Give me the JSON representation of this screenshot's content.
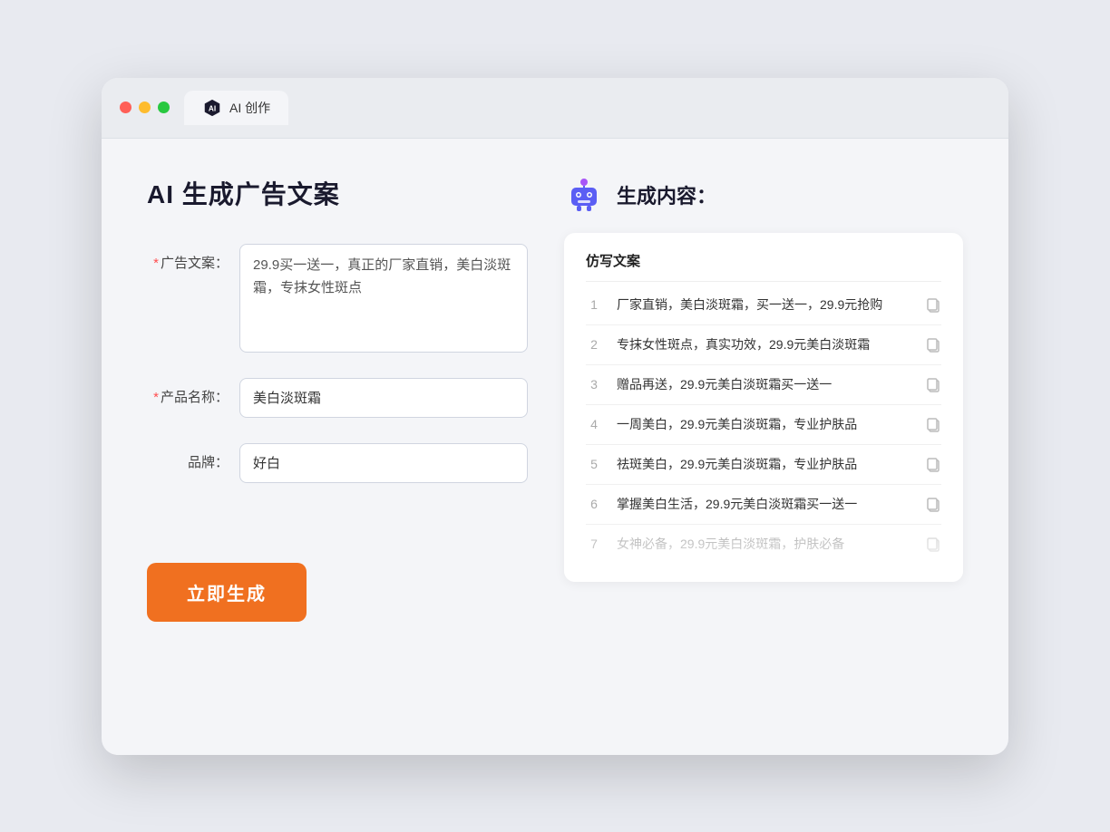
{
  "window": {
    "tab_label": "AI 创作"
  },
  "left_panel": {
    "title": "AI 生成广告文案",
    "fields": [
      {
        "id": "ad_copy",
        "label": "广告文案：",
        "required": true,
        "type": "textarea",
        "value": "29.9买一送一，真正的厂家直销，美白淡斑霜，专抹女性斑点"
      },
      {
        "id": "product_name",
        "label": "产品名称：",
        "required": true,
        "type": "text",
        "value": "美白淡斑霜"
      },
      {
        "id": "brand",
        "label": "品牌：",
        "required": false,
        "type": "text",
        "value": "好白"
      }
    ],
    "generate_btn": "立即生成"
  },
  "right_panel": {
    "title": "生成内容：",
    "column_header": "仿写文案",
    "results": [
      {
        "num": "1",
        "text": "厂家直销，美白淡斑霜，买一送一，29.9元抢购",
        "faded": false
      },
      {
        "num": "2",
        "text": "专抹女性斑点，真实功效，29.9元美白淡斑霜",
        "faded": false
      },
      {
        "num": "3",
        "text": "赠品再送，29.9元美白淡斑霜买一送一",
        "faded": false
      },
      {
        "num": "4",
        "text": "一周美白，29.9元美白淡斑霜，专业护肤品",
        "faded": false
      },
      {
        "num": "5",
        "text": "祛斑美白，29.9元美白淡斑霜，专业护肤品",
        "faded": false
      },
      {
        "num": "6",
        "text": "掌握美白生活，29.9元美白淡斑霜买一送一",
        "faded": false
      },
      {
        "num": "7",
        "text": "女神必备，29.9元美白淡斑霜，护肤必备",
        "faded": true
      }
    ]
  },
  "colors": {
    "accent_orange": "#f07020",
    "required_red": "#ff4d4f",
    "robot_blue": "#5b5ef4",
    "robot_purple": "#a855f7"
  }
}
